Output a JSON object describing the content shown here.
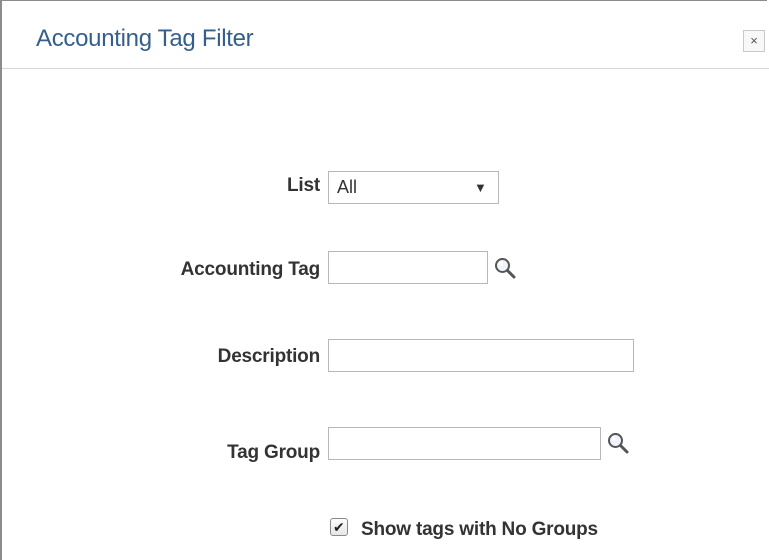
{
  "dialog": {
    "title": "Accounting Tag Filter",
    "close_label": "×"
  },
  "form": {
    "list": {
      "label": "List",
      "selected": "All",
      "arrow": "▼"
    },
    "accounting_tag": {
      "label": "Accounting Tag",
      "value": "",
      "lookup_icon": "magnifier-icon"
    },
    "description": {
      "label": "Description",
      "value": ""
    },
    "tag_group": {
      "label": "Tag Group",
      "value": "",
      "lookup_icon": "magnifier-icon"
    },
    "show_no_groups": {
      "label": "Show tags with No Groups",
      "checked": true,
      "check_glyph": "✔"
    }
  },
  "colors": {
    "title": "#355f8a",
    "label": "#333333",
    "border": "#b8b8b8"
  }
}
